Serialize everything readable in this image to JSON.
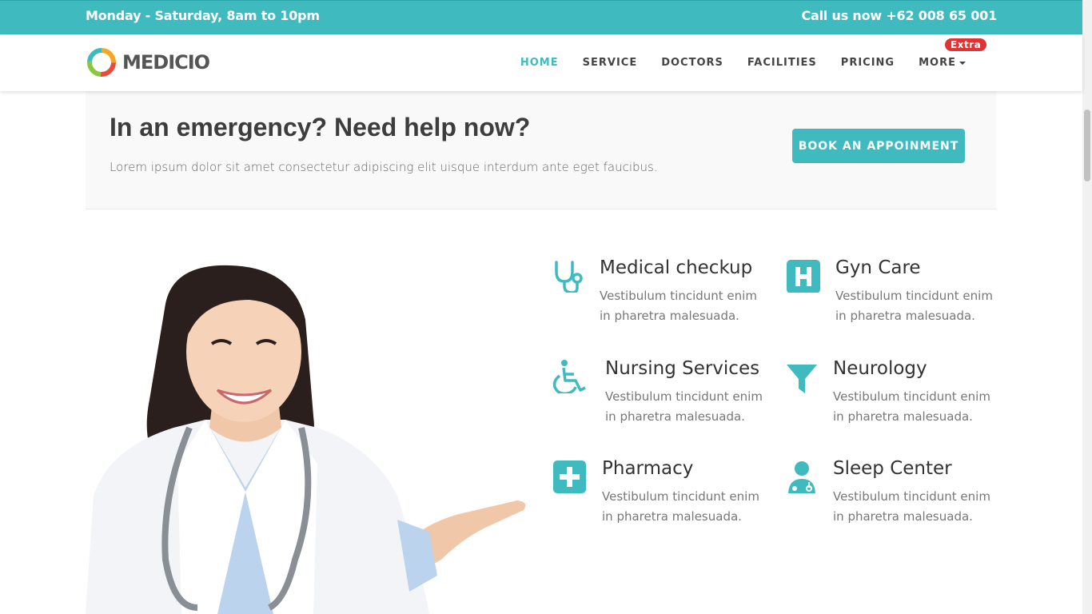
{
  "topbar": {
    "hours": "Monday - Saturday, 8am to 10pm",
    "call": "Call us now +62 008 65 001"
  },
  "brand": {
    "name": "MEDICIO"
  },
  "nav": {
    "items": [
      {
        "label": "HOME"
      },
      {
        "label": "SERVICE"
      },
      {
        "label": "DOCTORS"
      },
      {
        "label": "FACILITIES"
      },
      {
        "label": "PRICING"
      },
      {
        "label": "MORE"
      }
    ],
    "badge": "Extra"
  },
  "emergency": {
    "heading": "In an emergency? Need help now?",
    "text": "Lorem ipsum dolor sit amet consectetur adipiscing elit uisque interdum ante eget faucibus.",
    "button": "BOOK AN APPOINMENT"
  },
  "services": [
    {
      "title": "Medical checkup",
      "desc": "Vestibulum tincidunt enim in pharetra malesuada.",
      "icon": "stethoscope-icon"
    },
    {
      "title": "Gyn Care",
      "desc": "Vestibulum tincidunt enim in pharetra malesuada.",
      "icon": "hospital-h-icon"
    },
    {
      "title": "Nursing Services",
      "desc": "Vestibulum tincidunt enim in pharetra malesuada.",
      "icon": "wheelchair-icon"
    },
    {
      "title": "Neurology",
      "desc": "Vestibulum tincidunt enim in pharetra malesuada.",
      "icon": "filter-icon"
    },
    {
      "title": "Pharmacy",
      "desc": "Vestibulum tincidunt enim in pharetra malesuada.",
      "icon": "plus-square-icon"
    },
    {
      "title": "Sleep Center",
      "desc": "Vestibulum tincidunt enim in pharetra malesuada.",
      "icon": "user-doctor-icon"
    }
  ],
  "colors": {
    "accent": "#3fbbc0",
    "badge": "#e03333"
  }
}
